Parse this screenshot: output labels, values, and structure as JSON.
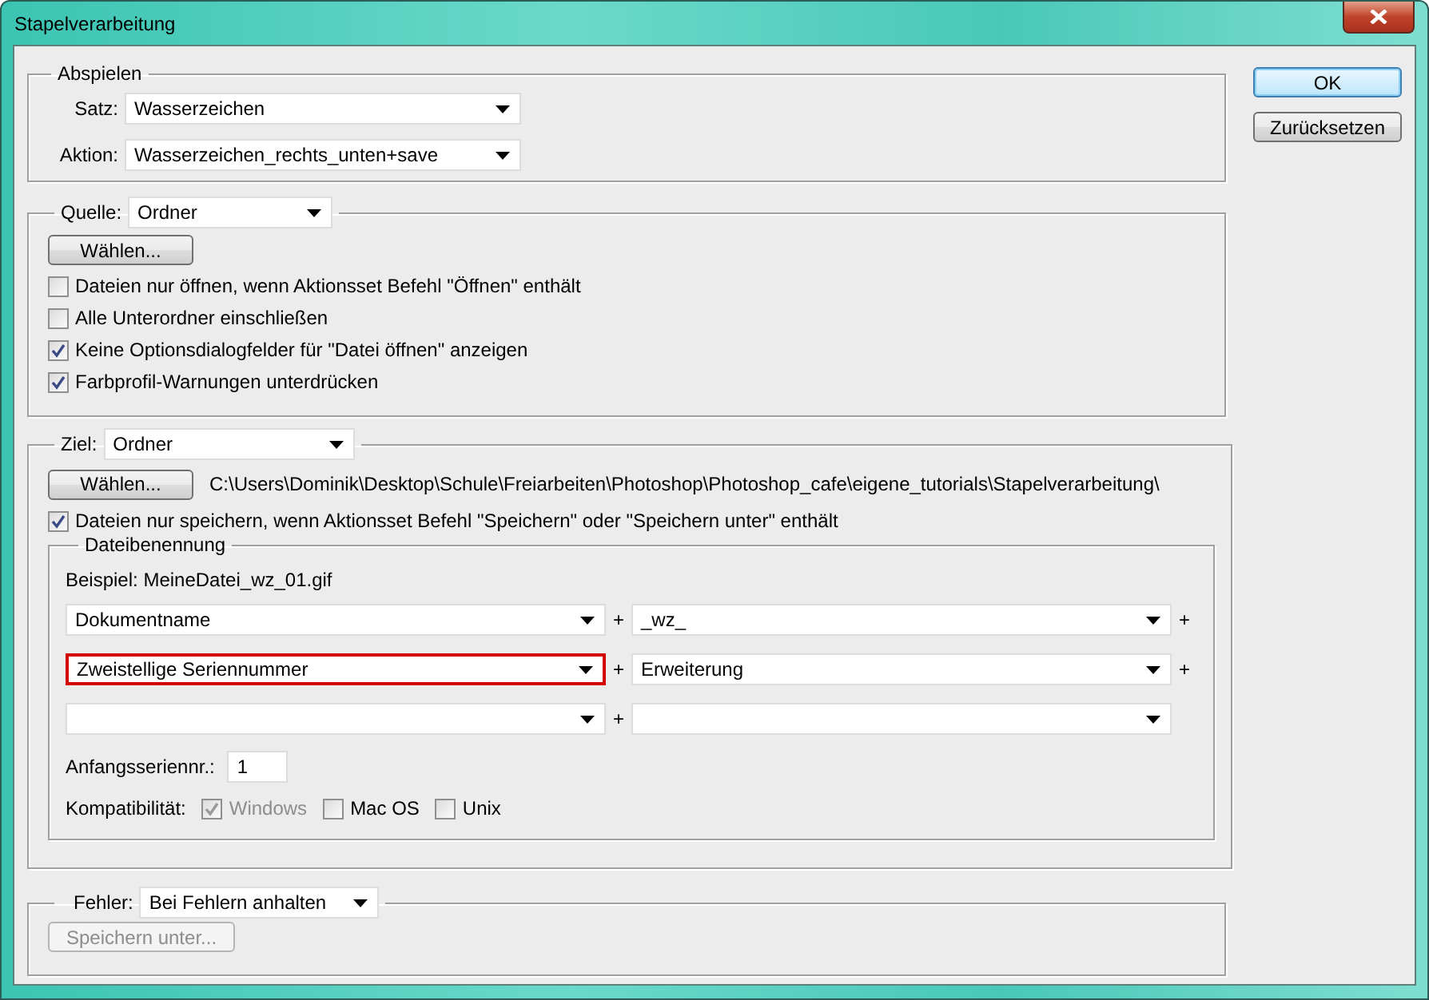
{
  "window": {
    "title": "Stapelverarbeitung"
  },
  "buttons": [
    {
      "label": "OK",
      "default": true
    },
    {
      "label": "Zurücksetzen",
      "default": false
    }
  ],
  "abspielen": {
    "title": "Abspielen",
    "fields": [
      {
        "label": "Satz:",
        "value": "Wasserzeichen"
      },
      {
        "label": "Aktion:",
        "value": "Wasserzeichen_rechts_unten+save"
      }
    ]
  },
  "quelle": {
    "label": "Quelle:",
    "value": "Ordner",
    "choose_button": "Wählen...",
    "options": [
      {
        "label": "Dateien nur öffnen, wenn Aktionsset Befehl \"Öffnen\" enthält",
        "checked": false
      },
      {
        "label": "Alle Unterordner einschließen",
        "checked": false
      },
      {
        "label": "Keine Optionsdialogfelder für \"Datei öffnen\" anzeigen",
        "checked": true
      },
      {
        "label": "Farbprofil-Warnungen unterdrücken",
        "checked": true
      }
    ]
  },
  "ziel": {
    "label": "Ziel:",
    "value": "Ordner",
    "choose_button": "Wählen...",
    "path": "C:\\Users\\Dominik\\Desktop\\Schule\\Freiarbeiten\\Photoshop\\Photoshop_cafe\\eigene_tutorials\\Stapelverarbeitung\\",
    "option": {
      "label": "Dateien nur speichern, wenn Aktionsset Befehl \"Speichern\" oder \"Speichern unter\" enthält",
      "checked": true
    },
    "naming": {
      "title": "Dateibenennung",
      "example": "Beispiel: MeineDatei_wz_01.gif",
      "rows": [
        {
          "cells": [
            {
              "value": "Dokumentname",
              "highlighted": false
            },
            {
              "value": "_wz_",
              "highlighted": false
            }
          ],
          "plus": [
            "+",
            "+"
          ]
        },
        {
          "cells": [
            {
              "value": "Zweistellige Seriennummer",
              "highlighted": true
            },
            {
              "value": "Erweiterung",
              "highlighted": false
            }
          ],
          "plus": [
            "+",
            "+"
          ]
        },
        {
          "cells": [
            {
              "highlighted": false
            },
            {
              "highlighted": false
            }
          ],
          "plus": [
            "+"
          ]
        }
      ],
      "start_serial": {
        "label": "Anfangsseriennr.:",
        "value": "1"
      },
      "compatibility": {
        "label": "Kompatibilität:",
        "options": [
          {
            "label": "Windows",
            "checked": true,
            "disabled": true
          },
          {
            "label": "Mac OS",
            "checked": false,
            "disabled": false
          },
          {
            "label": "Unix",
            "checked": false,
            "disabled": false
          }
        ]
      }
    }
  },
  "fehler": {
    "label": "Fehler:",
    "value": "Bei Fehlern anhalten",
    "save_button": {
      "label": "Speichern unter...",
      "disabled": true
    }
  }
}
